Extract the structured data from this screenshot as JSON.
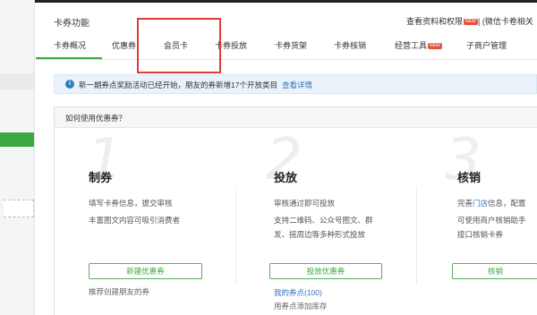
{
  "header": {
    "title": "卡券功能",
    "link": "查看资料和权限",
    "link_badge": "NEW",
    "extra": "| (微信卡卷相关"
  },
  "tabs": [
    {
      "label": "卡券概况"
    },
    {
      "label": "优惠券"
    },
    {
      "label": "会员卡"
    },
    {
      "label": "卡券投放"
    },
    {
      "label": "卡券货架"
    },
    {
      "label": "卡券核销"
    },
    {
      "label": "经营工具",
      "badge": "NEW"
    },
    {
      "label": "子商户管理"
    }
  ],
  "notice": {
    "icon": "i",
    "text": "新一期券点奖励活动已经开始，朋友的券新增17个开放类目",
    "link": "查看详情"
  },
  "card": {
    "header": "如何使用优惠券？",
    "steps": [
      {
        "number": "1",
        "title": "制券",
        "desc1": "填写卡券信息，提交审核",
        "desc2": "丰富图文内容可吸引消费者",
        "button": "新建优惠券",
        "foot": "推荐创建朋友的券"
      },
      {
        "number": "2",
        "title": "投放",
        "desc1": "审核通过即可投放",
        "desc2": "支持二维码、公众号图文、群",
        "desc3": "发、摇周边等多种形式投放",
        "button": "投放优惠券",
        "foot_link": "我的券点(100)",
        "foot2": "用券点添加库存"
      },
      {
        "number": "3",
        "title": "核销",
        "desc1_pre": "完善",
        "desc1_link": "门店",
        "desc1_post": "信息，配置",
        "desc2": "可使用商户核销助手",
        "desc3": "接口核销卡券",
        "button": "核销"
      }
    ]
  },
  "colors": {
    "accent_green": "#3aa83f",
    "highlight_red": "#e03c3c",
    "link_blue": "#3a73b8",
    "notice_bg": "#eaf3fb"
  },
  "icons": {
    "notice": "info-circle-icon"
  }
}
